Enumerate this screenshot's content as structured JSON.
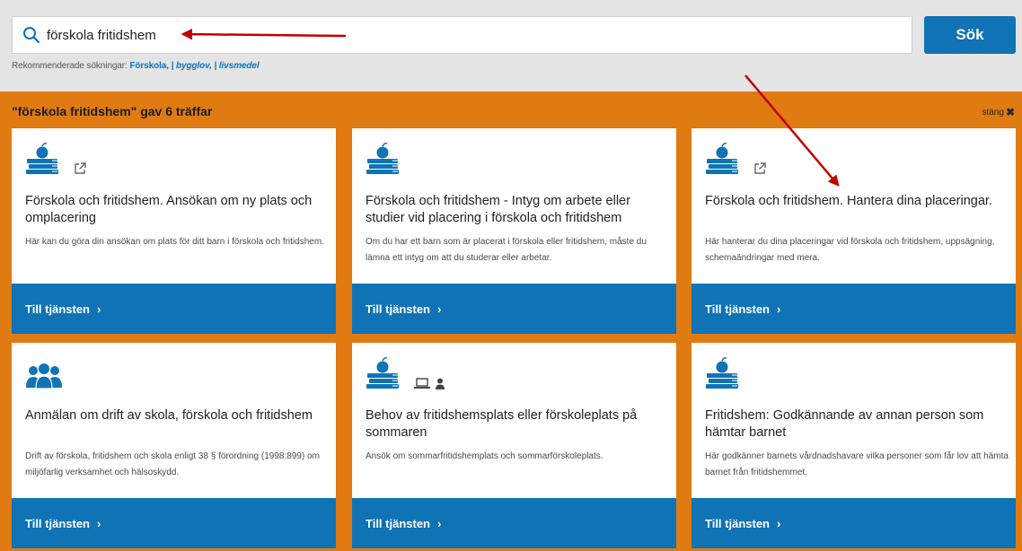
{
  "search": {
    "value": "förskola fritidshem",
    "button_label": "Sök"
  },
  "recommended": {
    "label": "Rekommenderade sökningar:",
    "links": [
      "Förskola,",
      "| bygglov,",
      "| livsmedel"
    ]
  },
  "results": {
    "title": "\"förskola fritidshem\" gav 6 träffar",
    "close_label": "stäng"
  },
  "cards": [
    {
      "title": "Förskola och fritidshem. Ansökan om ny plats och omplacering",
      "description": "Här kan du göra din ansökan om plats för ditt barn i förskola och fritidshem.",
      "cta": "Till tjänsten",
      "icons": [
        "books-apple-icon",
        "external-link-icon"
      ]
    },
    {
      "title": "Förskola och fritidshem - Intyg om arbete eller studier vid placering i förskola och fritidshem",
      "description": "Om du har ett barn som är placerat i förskola eller fritidshem, måste du lämna ett intyg om att du studerar eller arbetar.",
      "cta": "Till tjänsten",
      "icons": [
        "books-apple-icon"
      ]
    },
    {
      "title": "Förskola och fritidshem. Hantera dina placeringar.",
      "description": "Här hanterar du dina placeringar vid förskola och fritidshem, uppsägning, schemaändringar med mera.",
      "cta": "Till tjänsten",
      "icons": [
        "books-apple-icon",
        "external-link-icon"
      ]
    },
    {
      "title": "Anmälan om drift av skola, förskola och fritidshem",
      "description": "Drift av förskola, fritidshem och skola enligt 38 § förordning (1998:899) om miljöfarlig verksamhet och hälsoskydd.",
      "cta": "Till tjänsten",
      "icons": [
        "people-group-icon"
      ]
    },
    {
      "title": "Behov av fritidshemsplats eller förskoleplats på sommaren",
      "description": "Ansök om sommarfritidshemplats och sommarförskoleplats.",
      "cta": "Till tjänsten",
      "icons": [
        "books-apple-icon",
        "laptop-icon",
        "person-icon"
      ]
    },
    {
      "title": "Fritidshem: Godkännande av annan person som hämtar barnet",
      "description": "Här godkänner barnets vårdnadshavare vilka personer som får lov att hämta barnet från fritidshemmet.",
      "cta": "Till tjänsten",
      "icons": [
        "books-apple-icon"
      ]
    }
  ],
  "colors": {
    "brand_blue": "#0f73b6",
    "results_orange": "#e07b12",
    "annotation_red": "#c00000"
  }
}
